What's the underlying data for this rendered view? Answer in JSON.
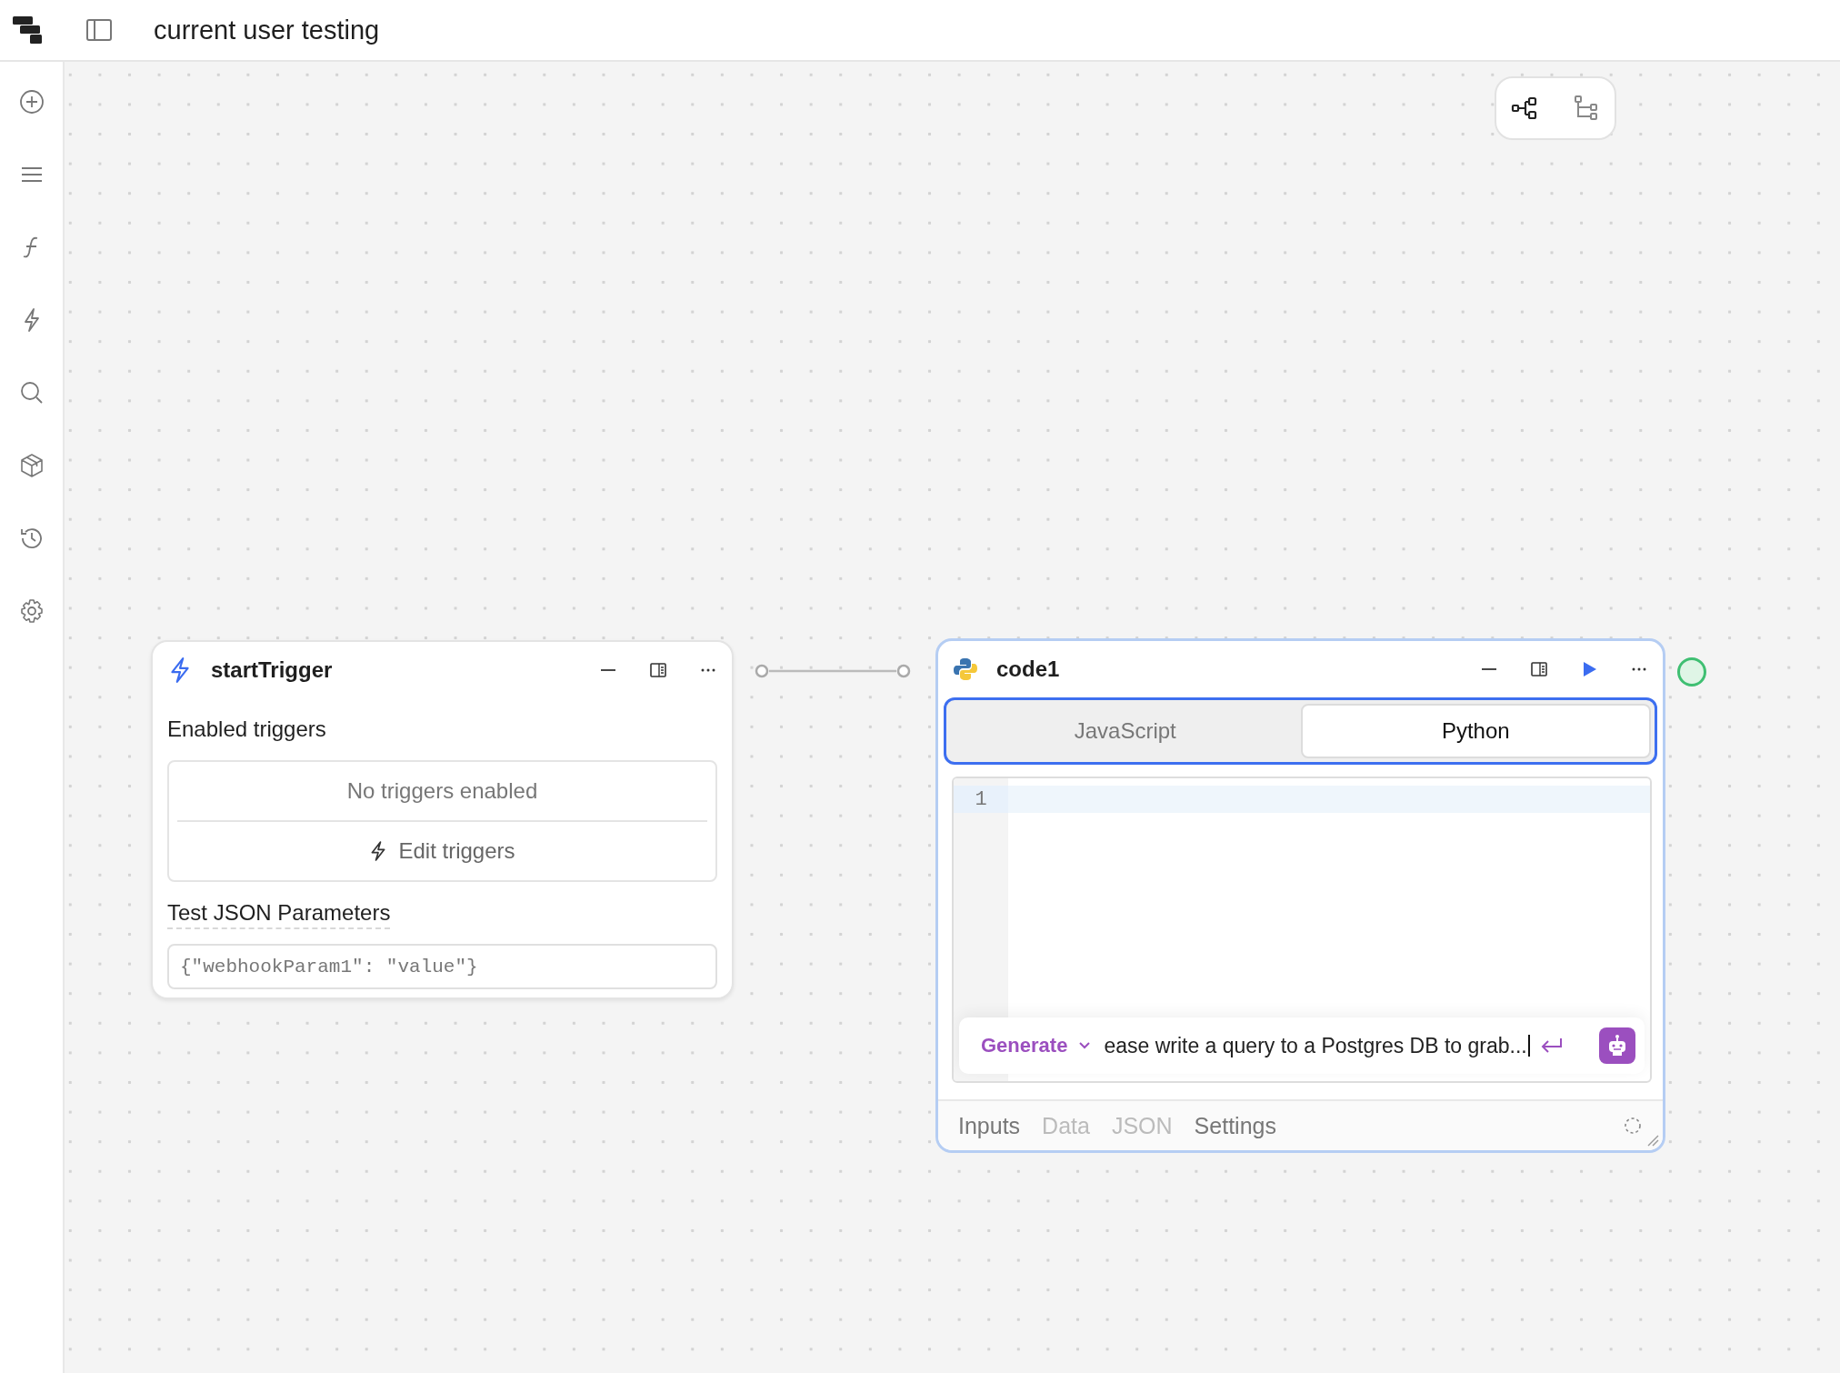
{
  "app": {
    "title": "current user testing"
  },
  "layout_buttons": [
    {
      "selected": true
    },
    {
      "selected": false
    }
  ],
  "trigger_node": {
    "title": "startTrigger",
    "section_label": "Enabled triggers",
    "empty_text": "No triggers enabled",
    "edit_button": "Edit triggers",
    "params_label": "Test JSON Parameters",
    "params_placeholder": "{\"webhookParam1\": \"value\"}"
  },
  "code_node": {
    "title": "code1",
    "languages": [
      {
        "label": "JavaScript",
        "selected": false
      },
      {
        "label": "Python",
        "selected": true
      }
    ],
    "line_numbers": [
      "1"
    ],
    "generate": {
      "mode": "Generate",
      "prompt": "ease write a query to a Postgres DB to grab..."
    },
    "footer_tabs": [
      {
        "label": "Inputs",
        "disabled": false
      },
      {
        "label": "Data",
        "disabled": true
      },
      {
        "label": "JSON",
        "disabled": true
      },
      {
        "label": "Settings",
        "disabled": false
      }
    ]
  }
}
